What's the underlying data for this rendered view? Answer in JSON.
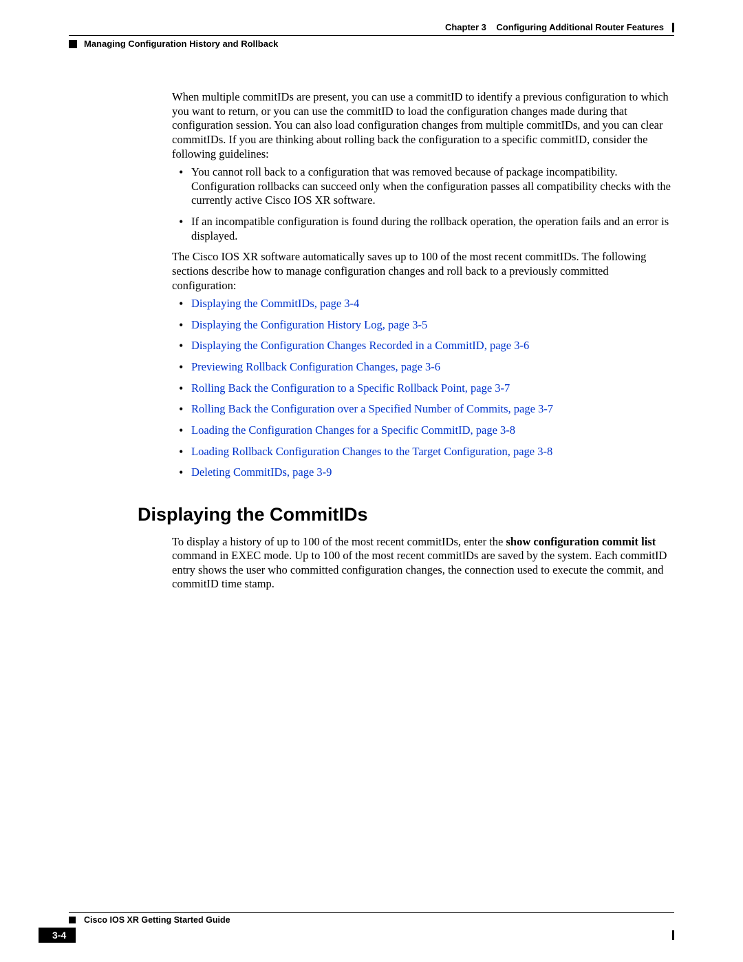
{
  "header": {
    "chapter_label": "Chapter 3",
    "chapter_title": "Configuring Additional Router Features",
    "section_title": "Managing Configuration History and Rollback"
  },
  "intro": {
    "para1": "When multiple commitIDs are present, you can use a commitID to identify a previous configuration to which you want to return, or you can use the commitID to load the configuration changes made during that configuration session. You can also load configuration changes from multiple commitIDs, and you can clear commitIDs. If you are thinking about rolling back the configuration to a specific commitID, consider the following guidelines:",
    "bullets": [
      "You cannot roll back to a configuration that was removed because of package incompatibility. Configuration rollbacks can succeed only when the configuration passes all compatibility checks with the currently active Cisco IOS XR software.",
      "If an incompatible configuration is found during the rollback operation, the operation fails and an error is displayed."
    ],
    "para2": "The Cisco IOS XR software automatically saves up to 100 of the most recent commitIDs. The following sections describe how to manage configuration changes and roll back to a previously committed configuration:",
    "links": [
      "Displaying the CommitIDs, page 3-4",
      "Displaying the Configuration History Log, page 3-5",
      "Displaying the Configuration Changes Recorded in a CommitID, page 3-6",
      "Previewing Rollback Configuration Changes, page 3-6",
      "Rolling Back the Configuration to a Specific Rollback Point, page 3-7",
      "Rolling Back the Configuration over a Specified Number of Commits, page 3-7",
      "Loading the Configuration Changes for a Specific CommitID, page 3-8",
      "Loading Rollback Configuration Changes to the Target Configuration, page 3-8",
      "Deleting CommitIDs, page 3-9"
    ]
  },
  "section": {
    "heading": "Displaying the CommitIDs",
    "body_pre": "To display a history of up to 100 of the most recent commitIDs, enter the ",
    "body_bold": "show configuration commit list",
    "body_post": " command in EXEC mode. Up to 100 of the most recent commitIDs are saved by the system. Each commitID entry shows the user who committed configuration changes, the connection used to execute the commit, and commitID time stamp."
  },
  "footer": {
    "guide_title": "Cisco IOS XR Getting Started Guide",
    "page_number": "3-4"
  }
}
